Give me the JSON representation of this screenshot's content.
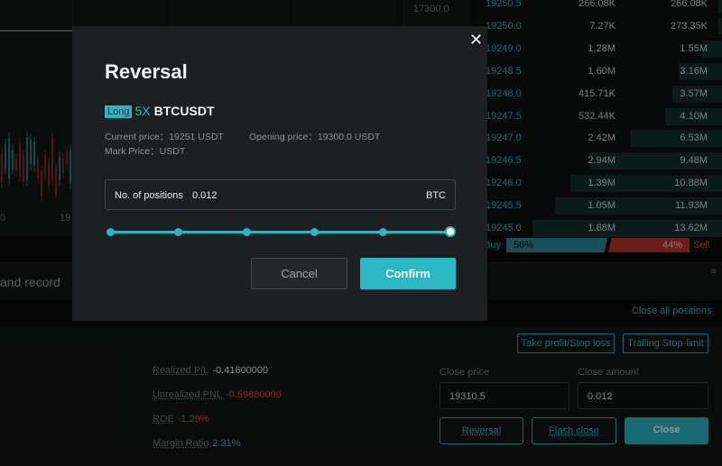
{
  "chart": {
    "price_label": "17300.0",
    "time_labels": [
      "0",
      "19"
    ]
  },
  "order_book": {
    "rows": [
      {
        "price": "19250.5",
        "amount": "266.08K",
        "total": "266.08K",
        "depth": 0.02
      },
      {
        "price": "19250.0",
        "amount": "7.27K",
        "total": "273.35K",
        "depth": 0.02
      },
      {
        "price": "19249.0",
        "amount": "1.28M",
        "total": "1.55M",
        "depth": 0.11
      },
      {
        "price": "19248.5",
        "amount": "1.60M",
        "total": "3.16M",
        "depth": 0.23
      },
      {
        "price": "19248.0",
        "amount": "415.71K",
        "total": "3.57M",
        "depth": 0.26
      },
      {
        "price": "19247.5",
        "amount": "532.44K",
        "total": "4.10M",
        "depth": 0.3
      },
      {
        "price": "19247.0",
        "amount": "2.42M",
        "total": "6.53M",
        "depth": 0.48
      },
      {
        "price": "19246.5",
        "amount": "2.94M",
        "total": "9.48M",
        "depth": 0.7
      },
      {
        "price": "19246.0",
        "amount": "1.39M",
        "total": "10.88M",
        "depth": 0.8
      },
      {
        "price": "19245.5",
        "amount": "1.05M",
        "total": "11.93M",
        "depth": 0.88
      },
      {
        "price": "19245.0",
        "amount": "1.68M",
        "total": "13.62M",
        "depth": 1.0
      }
    ],
    "buy_label": "Buy",
    "buy_pct": "56%",
    "sell_pct": "44%",
    "sell_label": "Sell"
  },
  "bottom": {
    "record_tab": "and record",
    "close_all": "Close all positions",
    "tp_sl": "Take profit/Stop loss",
    "trailing": "Trailing Stop-limit",
    "stats": [
      {
        "label": "Realized P/L",
        "value": "-0.41600000",
        "color": "#e8eaec"
      },
      {
        "label": "Unrealized PNL",
        "value": "-0.59880000",
        "color": "#e44b43"
      },
      {
        "label": "ROE",
        "value": "-1.29%",
        "color": "#e44b43"
      },
      {
        "label": "Margin Ratio",
        "value": "2.31%",
        "color": "#2bb6c3"
      }
    ],
    "close_price_label": "Close price",
    "close_price_value": "19310.5",
    "close_amount_label": "Close amount",
    "close_amount_value": "0.012",
    "reversal_btn": "Reversal",
    "flash_close_btn": "Flash close",
    "close_btn": "Close"
  },
  "modal": {
    "title": "Reversal",
    "side_tag": "Long",
    "leverage": "5X",
    "symbol": "BTCUSDT",
    "current_price": "Current price：19251 USDT",
    "opening_price": "Opening price：19300.0 USDT",
    "mark_price": "Mark Price：USDT",
    "positions_label": "No. of positions",
    "positions_value": "0.012",
    "positions_unit": "BTC",
    "slider_fraction": 1.0,
    "cancel": "Cancel",
    "confirm": "Confirm"
  },
  "colors": {
    "accent": "#2bb6c3",
    "sell": "#e44b43"
  }
}
